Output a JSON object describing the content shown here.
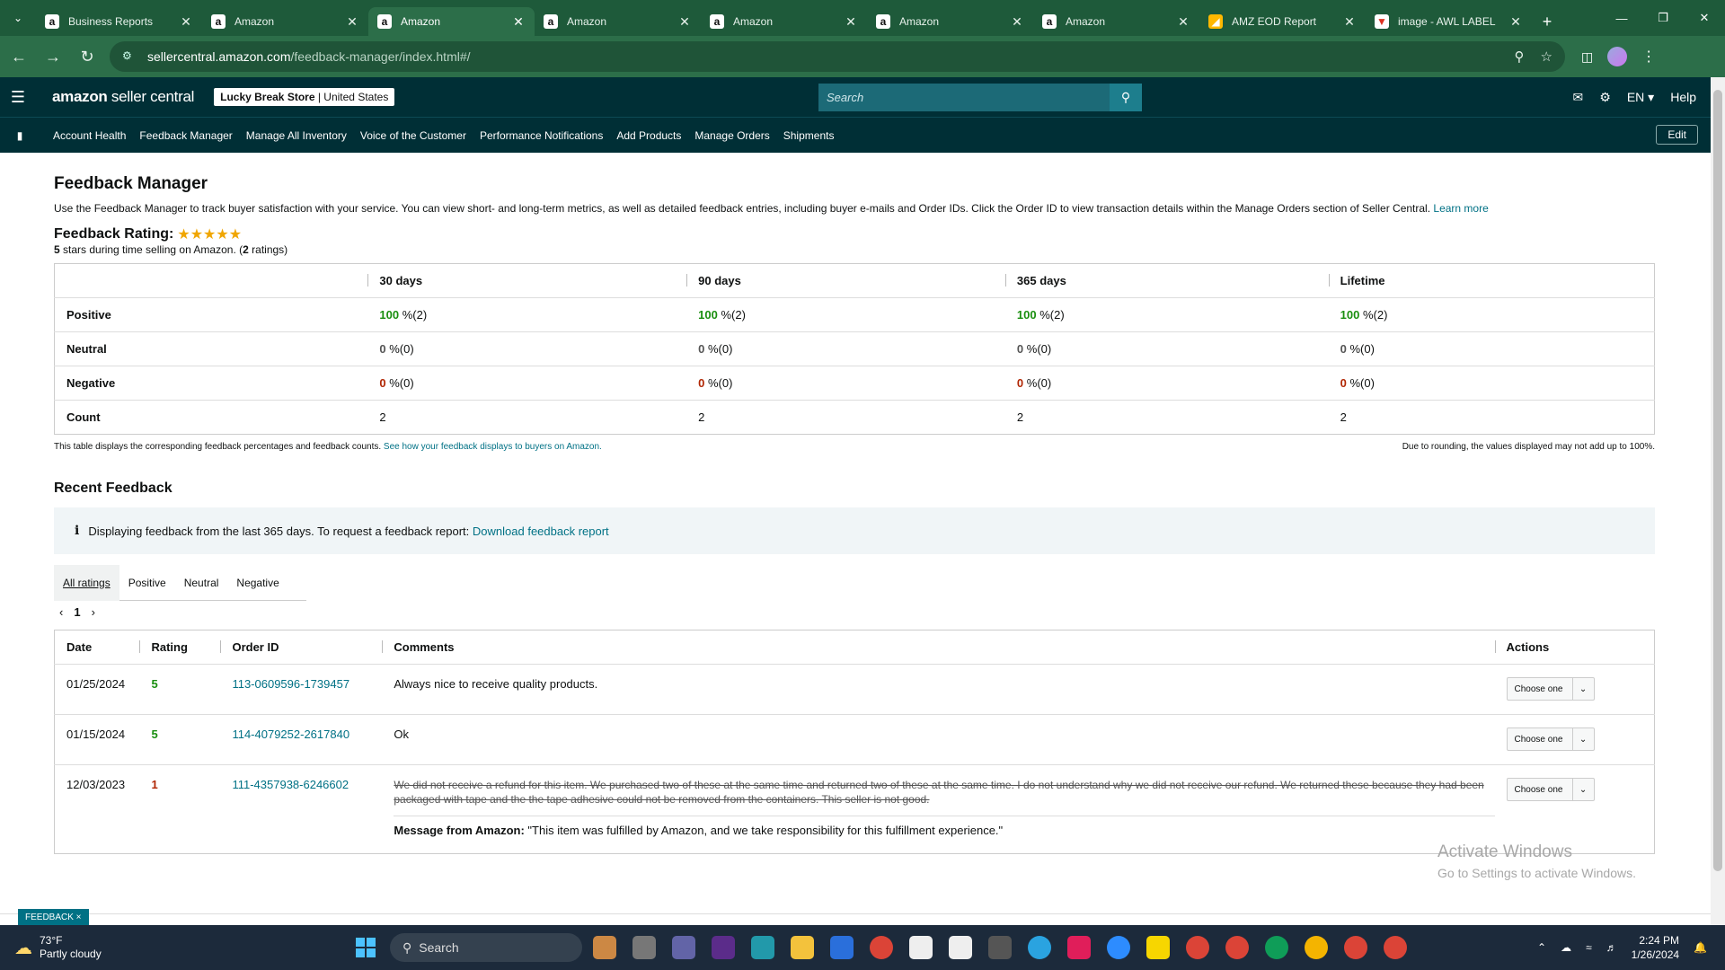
{
  "browser": {
    "tabs": [
      {
        "title": "Business Reports",
        "fav": "a",
        "active": false
      },
      {
        "title": "Amazon",
        "fav": "a",
        "active": false
      },
      {
        "title": "Amazon",
        "fav": "a",
        "active": true
      },
      {
        "title": "Amazon",
        "fav": "a",
        "active": false
      },
      {
        "title": "Amazon",
        "fav": "a",
        "active": false
      },
      {
        "title": "Amazon",
        "fav": "a",
        "active": false
      },
      {
        "title": "Amazon",
        "fav": "a",
        "active": false
      },
      {
        "title": "AMZ EOD Report",
        "fav": "report",
        "active": false
      },
      {
        "title": "image - AWL LABEL",
        "fav": "t",
        "active": false
      }
    ],
    "url_host": "sellercentral.amazon.com",
    "url_path": "/feedback-manager/index.html#/"
  },
  "header": {
    "logo_bold": "amazon",
    "logo_light": " seller central",
    "store_name": "Lucky Break Store",
    "store_region": "United States",
    "search_placeholder": "Search",
    "lang": "EN",
    "help": "Help"
  },
  "nav": {
    "links": [
      "Account Health",
      "Feedback Manager",
      "Manage All Inventory",
      "Voice of the Customer",
      "Performance Notifications",
      "Add Products",
      "Manage Orders",
      "Shipments"
    ],
    "edit": "Edit"
  },
  "page": {
    "title": "Feedback Manager",
    "description": "Use the Feedback Manager to track buyer satisfaction with your service. You can view short- and long-term metrics, as well as detailed feedback entries, including buyer e-mails and Order IDs. Click the Order ID to view transaction details within the Manage Orders section of Seller Central.",
    "learn_more": "Learn more",
    "rating_label": "Feedback Rating:",
    "rating_stars": 5,
    "rating_sub_prefix": "5",
    "rating_sub_mid": " stars during time selling on Amazon. (",
    "rating_sub_count": "2",
    "rating_sub_suffix": " ratings)"
  },
  "metrics": {
    "columns": [
      "30 days",
      "90 days",
      "365 days",
      "Lifetime"
    ],
    "rows": [
      {
        "label": "Positive",
        "cells": [
          {
            "v": "100",
            "rest": " %(2)"
          },
          {
            "v": "100",
            "rest": " %(2)"
          },
          {
            "v": "100",
            "rest": " %(2)"
          },
          {
            "v": "100",
            "rest": " %(2)"
          }
        ]
      },
      {
        "label": "Neutral",
        "cells": [
          {
            "v": "0",
            "rest": " %(0)"
          },
          {
            "v": "0",
            "rest": " %(0)"
          },
          {
            "v": "0",
            "rest": " %(0)"
          },
          {
            "v": "0",
            "rest": " %(0)"
          }
        ]
      },
      {
        "label": "Negative",
        "cells": [
          {
            "v": "0",
            "rest": " %(0)"
          },
          {
            "v": "0",
            "rest": " %(0)"
          },
          {
            "v": "0",
            "rest": " %(0)"
          },
          {
            "v": "0",
            "rest": " %(0)"
          }
        ]
      },
      {
        "label": "Count",
        "cells": [
          {
            "v": "2"
          },
          {
            "v": "2"
          },
          {
            "v": "2"
          },
          {
            "v": "2"
          }
        ]
      }
    ],
    "foot_left": "This table displays the corresponding feedback percentages and feedback counts.",
    "foot_left_link": "See how your feedback displays to buyers on Amazon.",
    "foot_right": "Due to rounding, the values displayed may not add up to 100%."
  },
  "recent": {
    "title": "Recent Feedback",
    "info_text": "Displaying feedback from the last 365 days. To request a feedback report:",
    "info_link": "Download feedback report",
    "tabs": [
      "All ratings",
      "Positive",
      "Neutral",
      "Negative"
    ],
    "page": "1",
    "headers": [
      "Date",
      "Rating",
      "Order ID",
      "Comments",
      "Actions"
    ],
    "rows": [
      {
        "date": "01/25/2024",
        "rating": "5",
        "order": "113-0609596-1739457",
        "comment": "Always nice to receive quality products.",
        "action": "Choose one"
      },
      {
        "date": "01/15/2024",
        "rating": "5",
        "order": "114-4079252-2617840",
        "comment": "Ok",
        "action": "Choose one"
      },
      {
        "date": "12/03/2023",
        "rating": "1",
        "order": "111-4357938-6246602",
        "comment": "We did not receive a refund for this item. We purchased two of these at the same time and returned two of these at the same time. I do not understand why we did not receive our refund. We returned these because they had been packaged with tape and the the tape adhesive could not be removed from the containers. This seller is not good.",
        "action": "Choose one",
        "msg_label": "Message from Amazon:",
        "msg_text": " \"This item was fulfilled by Amazon, and we take responsibility for this fulfillment experience.\""
      }
    ]
  },
  "overlay": {
    "activate_title": "Activate Windows",
    "activate_sub": "Go to Settings to activate Windows.",
    "feedback_chip": "FEEDBACK ×"
  },
  "taskbar": {
    "temp": "73°F",
    "weather": "Partly cloudy",
    "search": "Search",
    "time": "2:24 PM",
    "date": "1/26/2024"
  }
}
